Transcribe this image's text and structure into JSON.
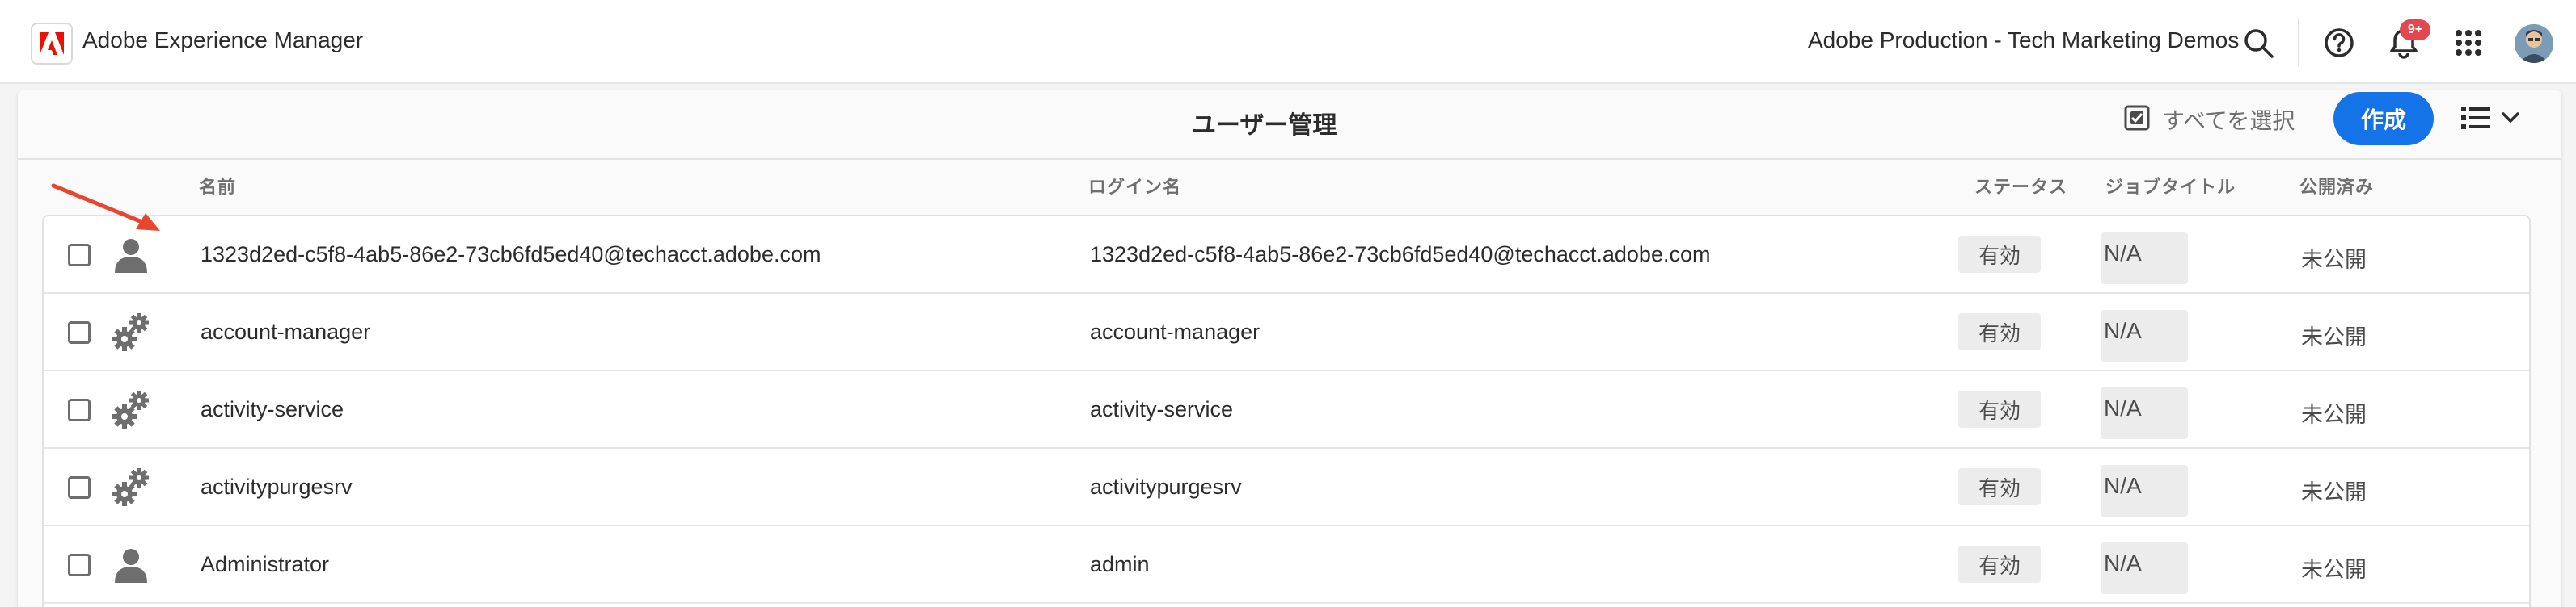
{
  "shell": {
    "app_title": "Adobe Experience Manager",
    "org_name": "Adobe Production - Tech Marketing Demos",
    "notification_badge": "9+",
    "icons": [
      "adobe-logo-icon",
      "search-icon",
      "help-icon",
      "bell-icon",
      "apps-grid-icon",
      "avatar"
    ]
  },
  "toolbar": {
    "title": "ユーザー管理",
    "select_all_label": "すべてを選択",
    "create_label": "作成"
  },
  "table": {
    "headers": {
      "name": "名前",
      "login": "ログイン名",
      "status": "ステータス",
      "job_title": "ジョブタイトル",
      "published": "公開済み"
    },
    "rows": [
      {
        "icon": "user-icon",
        "name": "1323d2ed-c5f8-4ab5-86e2-73cb6fd5ed40@techacct.adobe.com",
        "login": "1323d2ed-c5f8-4ab5-86e2-73cb6fd5ed40@techacct.adobe.com",
        "status": "有効",
        "job_title": "N/A",
        "published": "未公開"
      },
      {
        "icon": "service-gears-icon",
        "name": "account-manager",
        "login": "account-manager",
        "status": "有効",
        "job_title": "N/A",
        "published": "未公開"
      },
      {
        "icon": "service-gears-icon",
        "name": "activity-service",
        "login": "activity-service",
        "status": "有効",
        "job_title": "N/A",
        "published": "未公開"
      },
      {
        "icon": "service-gears-icon",
        "name": "activitypurgesrv",
        "login": "activitypurgesrv",
        "status": "有効",
        "job_title": "N/A",
        "published": "未公開"
      },
      {
        "icon": "user-icon",
        "name": "Administrator",
        "login": "admin",
        "status": "有効",
        "job_title": "N/A",
        "published": "未公開"
      }
    ]
  },
  "colors": {
    "accent": "#1473e6",
    "adobe_red": "#eb1000",
    "badge_red": "#e34850",
    "annotation_arrow": "#e8462e"
  }
}
